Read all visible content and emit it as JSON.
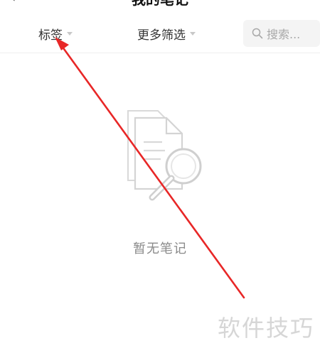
{
  "header": {
    "back_icon": "chevron-left-icon",
    "title": "我的笔记"
  },
  "filter_bar": {
    "tags_label": "标签",
    "more_filters_label": "更多筛选",
    "search_placeholder": "搜索..."
  },
  "empty_state": {
    "icon": "document-magnifier-icon",
    "message": "暂无笔记"
  },
  "watermark": "软件技巧",
  "annotation": {
    "type": "arrow",
    "color": "#e82727",
    "points_to": "tags-filter"
  }
}
